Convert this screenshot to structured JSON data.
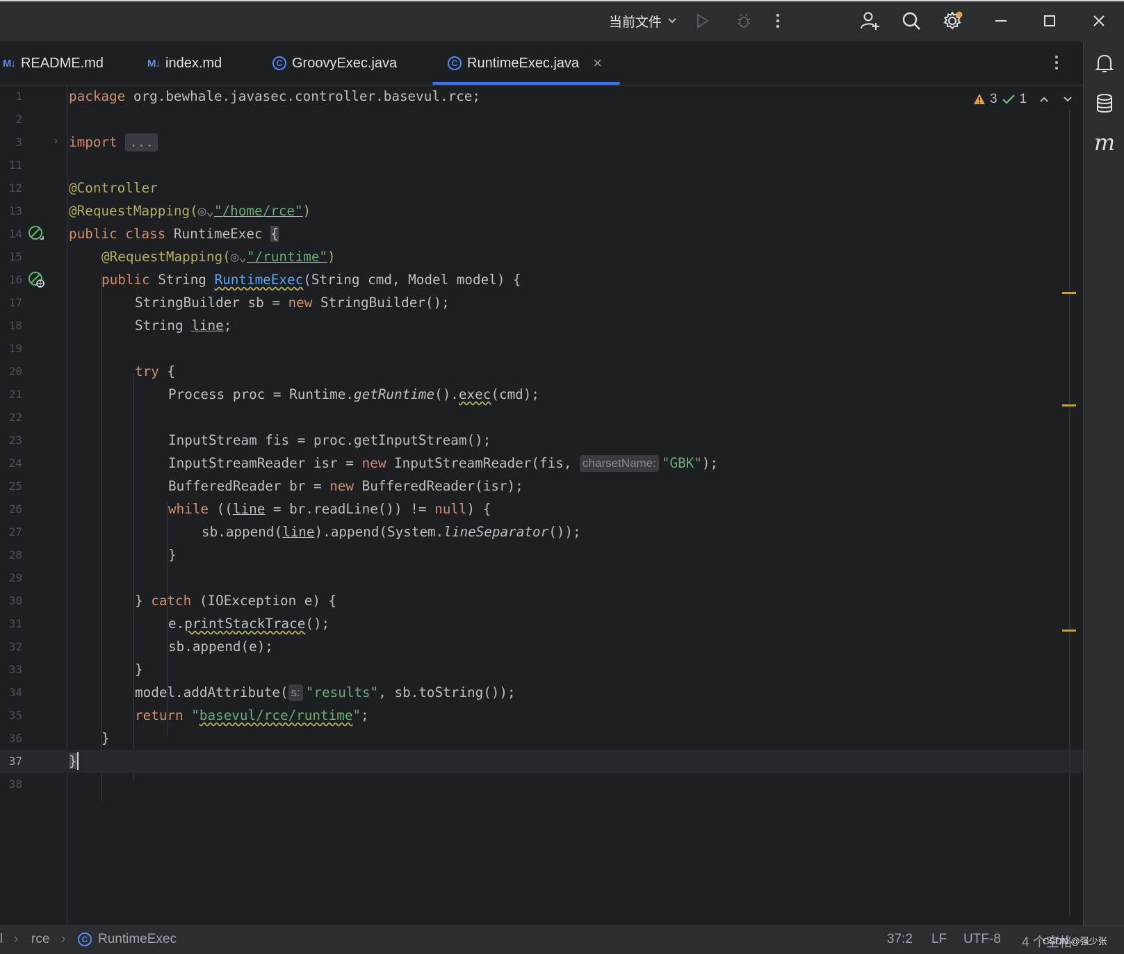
{
  "toolbar": {
    "run_config_label": "当前文件"
  },
  "tabs": [
    {
      "label": "README.md",
      "badge": "M↓"
    },
    {
      "label": "index.md",
      "badge": "M↓"
    },
    {
      "label": "GroovyExec.java",
      "badge": "C"
    },
    {
      "label": "RuntimeExec.java",
      "badge": "C",
      "active": true
    }
  ],
  "inspections": {
    "warnings": "3",
    "ok": "1"
  },
  "editor": {
    "line_numbers": [
      "1",
      "2",
      "3",
      "11",
      "12",
      "13",
      "14",
      "15",
      "16",
      "17",
      "18",
      "19",
      "20",
      "21",
      "22",
      "23",
      "24",
      "25",
      "26",
      "27",
      "28",
      "29",
      "30",
      "31",
      "32",
      "33",
      "34",
      "35",
      "36",
      "37",
      "38"
    ],
    "code": {
      "l1_kw": "package",
      "l1_rest": " org.bewhale.javasec.controller.basevul.rce;",
      "l3_kw": "import",
      "l3_fold": "...",
      "l12": "@Controller",
      "l13_ann": "@RequestMapping(",
      "l13_str": "\"/home/rce\"",
      "l13_end": ")",
      "l14_kw": "public class",
      "l14_rest": " RuntimeExec ",
      "l14_brace": "{",
      "l15_ann": "@RequestMapping(",
      "l15_str": "\"/runtime\"",
      "l15_end": ")",
      "l16_kw": "public",
      "l16_a": " String ",
      "l16_fn": "RuntimeExec",
      "l16_b": "(String cmd, Model model) {",
      "l17_a": "StringBuilder sb = ",
      "l17_kw": "new",
      "l17_b": " StringBuilder();",
      "l18_a": "String ",
      "l18_var": "line",
      "l18_b": ";",
      "l20_kw": "try",
      "l20_b": " {",
      "l21_a": "Process proc = Runtime.",
      "l21_it": "getRuntime",
      "l21_b": "().",
      "l21_sq": "exec",
      "l21_c": "(cmd);",
      "l23": "InputStream fis = proc.getInputStream();",
      "l24_a": "InputStreamReader isr = ",
      "l24_kw": "new",
      "l24_b": " InputStreamReader(fis, ",
      "l24_hint": "charsetName:",
      "l24_str": "\"GBK\"",
      "l24_c": ");",
      "l25_a": "BufferedReader br = ",
      "l25_kw": "new",
      "l25_b": " BufferedReader(isr);",
      "l26_kw": "while",
      "l26_a": " ((",
      "l26_var": "line",
      "l26_b": " = br.readLine()) != ",
      "l26_kw2": "null",
      "l26_c": ") {",
      "l27_a": "sb.append(",
      "l27_var": "line",
      "l27_b": ").append(System.",
      "l27_it": "lineSeparator",
      "l27_c": "());",
      "l28": "}",
      "l30_a": "} ",
      "l30_kw": "catch",
      "l30_b": " (IOException e) {",
      "l31_a": "e.",
      "l31_sq": "printStackTrace",
      "l31_b": "();",
      "l32": "sb.append(e);",
      "l33": "}",
      "l34_a": "model.addAttribute(",
      "l34_hint": "s:",
      "l34_str": "\"results\"",
      "l34_b": ", sb.toString());",
      "l35_kw": "return",
      "l35_q1": " \"",
      "l35_path": "basevul/rce/runtime",
      "l35_q2": "\"",
      "l35_b": ";",
      "l36": "}",
      "l37": "}"
    }
  },
  "statusbar": {
    "crumb_prefix": "l",
    "crumb_1": "rce",
    "crumb_2": "RuntimeExec",
    "position": "37:2",
    "line_sep": "LF",
    "encoding": "UTF-8",
    "indent": "4 个空格",
    "watermark": "CSDN @强少张"
  },
  "colors": {
    "bg": "#1e1f22",
    "chrome": "#2b2d30",
    "keyword": "#cf8e6d",
    "annotation": "#b3ae60",
    "string": "#6aab73",
    "accent": "#3574f0"
  }
}
